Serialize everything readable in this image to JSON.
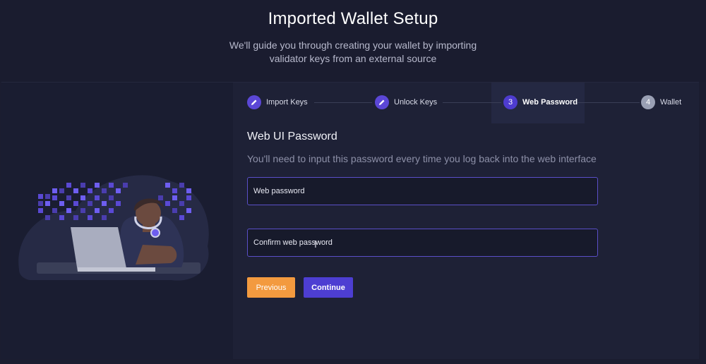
{
  "header": {
    "title": "Imported Wallet Setup",
    "subtitle": "We'll guide you through creating your wallet by importing validator keys from an external source"
  },
  "stepper": {
    "steps": [
      {
        "number": "1",
        "label": "Import Keys",
        "state": "done",
        "icon": "pencil-icon"
      },
      {
        "number": "2",
        "label": "Unlock Keys",
        "state": "done",
        "icon": "pencil-icon"
      },
      {
        "number": "3",
        "label": "Web Password",
        "state": "active"
      },
      {
        "number": "4",
        "label": "Wallet",
        "state": "pending"
      }
    ]
  },
  "form": {
    "title": "Web UI Password",
    "description": "You'll need to input this password every time you log back into the web interface",
    "password_placeholder": "Web password",
    "confirm_placeholder": "Confirm web password"
  },
  "buttons": {
    "previous": "Previous",
    "continue": "Continue"
  },
  "colors": {
    "accent": "#4d3ed2",
    "previous_button": "#f39a3f",
    "background": "#1b1d30"
  }
}
